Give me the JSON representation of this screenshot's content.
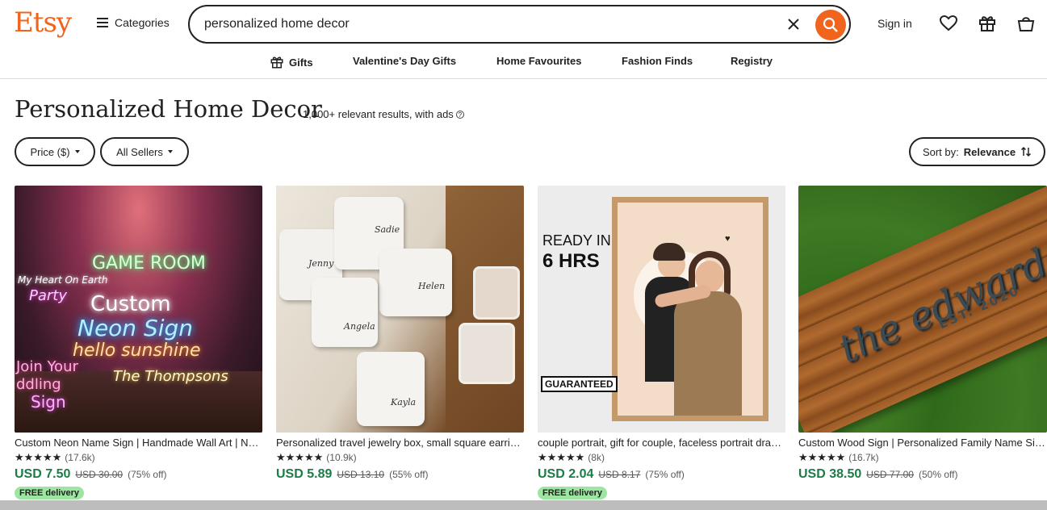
{
  "header": {
    "logo": "Etsy",
    "categories_label": "Categories",
    "search_value": "personalized home decor",
    "signin_label": "Sign in"
  },
  "nav": {
    "items": [
      "Gifts",
      "Valentine's Day Gifts",
      "Home Favourites",
      "Fashion Finds",
      "Registry"
    ]
  },
  "page": {
    "title": "Personalized Home Decor",
    "result_count": "1,000+ relevant results, with ads",
    "filters": {
      "price": "Price ($)",
      "sellers": "All Sellers"
    },
    "sort_prefix": "Sort by:",
    "sort_value": "Relevance"
  },
  "listings": [
    {
      "title": "Custom Neon Name Sign | Handmade Wall Art | Neon Light Sign",
      "stars": "★★★★★",
      "reviews": "(17.6k)",
      "price": "USD 7.50",
      "original": "USD 30.00",
      "discount": "(75% off)",
      "badge": "FREE delivery",
      "neon": [
        "GAME ROOM",
        "My Heart On Earth",
        "Party",
        "Custom",
        "Neon Sign",
        "hello sunshine",
        "The Thompsons",
        "Join Your",
        "ddling",
        "Sign"
      ]
    },
    {
      "title": "Personalized travel jewelry box, small square earring case",
      "stars": "★★★★★",
      "reviews": "(10.9k)",
      "price": "USD 5.89",
      "original": "USD 13.10",
      "discount": "(55% off)",
      "badge": "",
      "names": [
        "Jenny",
        "Sadie",
        "Helen",
        "Angela",
        "Kayla"
      ]
    },
    {
      "title": "couple portrait, gift for couple, faceless portrait drawing",
      "stars": "★★★★★",
      "reviews": "(8k)",
      "price": "USD 2.04",
      "original": "USD 8.17",
      "discount": "(75% off)",
      "badge": "FREE delivery",
      "ready_line1": "READY IN",
      "ready_line2": "6 HRS",
      "guaranteed": "GUARANTEED"
    },
    {
      "title": "Custom Wood Sign | Personalized Family Name Sign",
      "stars": "★★★★★",
      "reviews": "(16.7k)",
      "price": "USD 38.50",
      "original": "USD 77.00",
      "discount": "(50% off)",
      "badge": "",
      "sign_name": "the edwards",
      "sign_est": "EST. 2020"
    }
  ],
  "colors": {
    "brand": "#f1641e",
    "price": "#1c7c48",
    "badge": "#9ce6a2"
  }
}
